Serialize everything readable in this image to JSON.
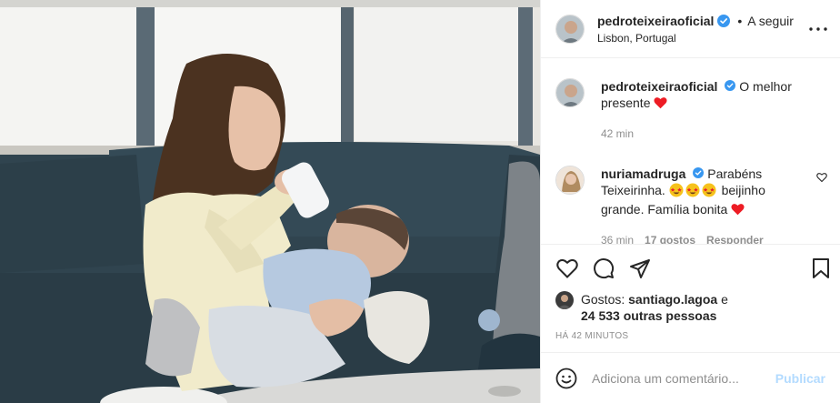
{
  "post": {
    "author": "pedroteixeiraoficial",
    "follow_label": "A seguir",
    "location": "Lisbon, Portugal",
    "caption": "O melhor presente",
    "caption_time": "42 min"
  },
  "comments": [
    {
      "user": "nuriamadruga",
      "text_1": "Parabéns Teixeirinha.",
      "text_2": "beijinho grande. Família bonita",
      "time": "36 min",
      "likes": "17 gostos",
      "reply": "Responder"
    }
  ],
  "likes": {
    "prefix": "Gostos:",
    "user": "santiago.lagoa",
    "connector": "e",
    "others": "24 533 outras pessoas"
  },
  "posted_ago": "HÁ 42 MINUTOS",
  "comment_box": {
    "placeholder": "Adiciona um comentário...",
    "publish_label": "Publicar"
  },
  "icons": {
    "verified": "verified-badge-icon",
    "more": "more-options-icon",
    "like": "heart-icon",
    "comment": "comment-icon",
    "share": "share-icon",
    "save": "bookmark-icon",
    "emoji": "emoji-icon"
  },
  "colors": {
    "verified": "#3897f0",
    "heart": "#ed1c24",
    "publish_disabled": "#b3dbff",
    "meta_grey": "#8e8e8e"
  }
}
